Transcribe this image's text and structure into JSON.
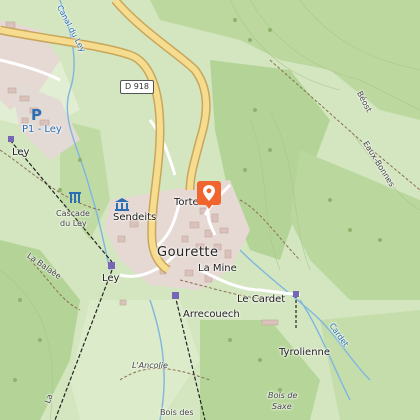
{
  "map": {
    "labels": {
      "road_ref": "D 918",
      "gourette": "Gourette",
      "la_mine": "La Mine",
      "le_cardet": "Le Cardet",
      "arrecouech": "Arrecouech",
      "tyrolienne": "Tyrolienne",
      "sendeits": "Sendeits",
      "tortes": "Tortes",
      "p1_ley": "P1 - Ley",
      "ley_top": "Ley",
      "ley_bottom": "Ley",
      "cascade_line1": "Cascade",
      "cascade_line2": "du Ley",
      "la_balaese": "La Balaèe",
      "lancolie": "L'Ancolie",
      "bois_des": "Bois des",
      "bois_de_saxe_1": "Bois de",
      "bois_de_saxe_2": "Saxe",
      "beost": "Béost",
      "eaux_bonnes": "Eaux-Bonnes",
      "canal_du_ley": "Canal du Ley",
      "cardet_stream": "Cardet",
      "la_bottom": "La"
    },
    "icons": {
      "parking": "parking-icon",
      "museum": "museum-icon",
      "waterfall": "waterfall-icon",
      "poi_pin": "location-pin-icon"
    },
    "colors": {
      "forest": "#b9d79a",
      "meadow": "#d6e8c2",
      "urban": "#e3d6d0",
      "road_fill": "#f6dc8f",
      "road_casing": "#c9a65a",
      "water": "#8fc3e8",
      "pin": "#f0642d",
      "lift": "#222222"
    }
  }
}
